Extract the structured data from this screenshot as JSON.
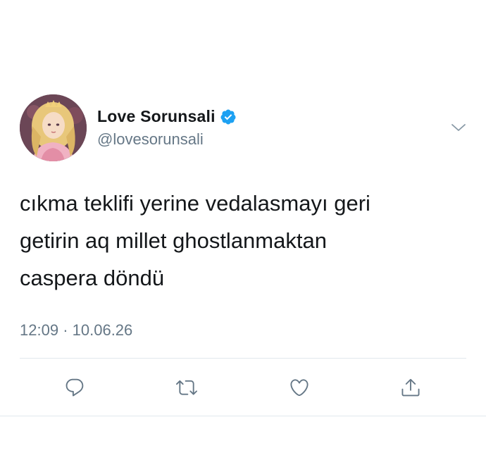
{
  "user": {
    "display_name": "Love Sorunsali",
    "handle": "@lovesorunsali",
    "verified": true,
    "avatar_icon": "princess-avatar"
  },
  "tweet": {
    "text": "cıkma teklifi yerine vedalasmayı geri\ngetirin aq millet ghostlanmaktan\ncaspera döndü",
    "time": "12:09",
    "separator": "·",
    "date": "10.06.26"
  },
  "icons": {
    "menu": "chevron-down-icon",
    "reply": "reply-icon",
    "retweet": "retweet-icon",
    "like": "heart-icon",
    "share": "share-icon"
  },
  "colors": {
    "text": "#14171a",
    "secondary": "#657786",
    "verified": "#1da1f2",
    "action_icon": "#657786",
    "divider": "#e1e8ed"
  }
}
